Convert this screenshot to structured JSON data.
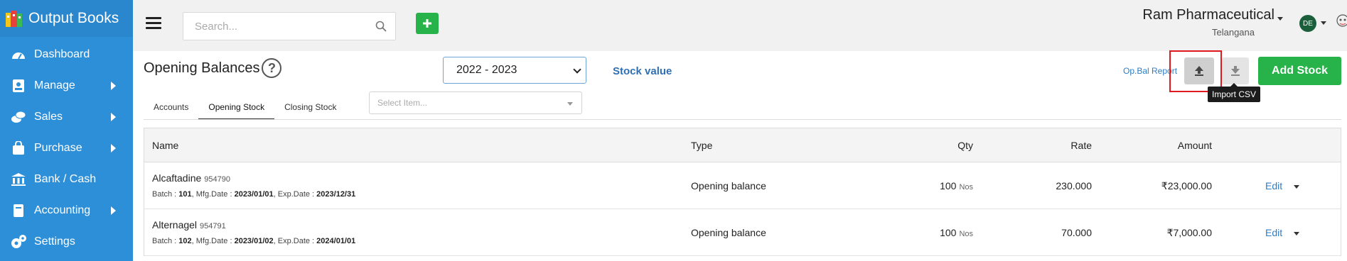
{
  "brand": {
    "name": "Output Books"
  },
  "sidebar": {
    "items": [
      {
        "label": "Dashboard",
        "icon": "dashboard-gauge-icon",
        "has_submenu": false
      },
      {
        "label": "Manage",
        "icon": "manage-id-card-icon",
        "has_submenu": true
      },
      {
        "label": "Sales",
        "icon": "sales-coins-icon",
        "has_submenu": true
      },
      {
        "label": "Purchase",
        "icon": "purchase-bag-icon",
        "has_submenu": true
      },
      {
        "label": "Bank / Cash",
        "icon": "bank-icon",
        "has_submenu": false
      },
      {
        "label": "Accounting",
        "icon": "accounting-book-icon",
        "has_submenu": true
      },
      {
        "label": "Settings",
        "icon": "settings-gears-icon",
        "has_submenu": false
      }
    ]
  },
  "header": {
    "search_placeholder": "Search...",
    "company_name": "Ram Pharmaceutical",
    "company_state": "Telangana",
    "avatar_initials": "DE"
  },
  "page": {
    "title": "Opening Balances",
    "help": "?",
    "year": "2022 - 2023",
    "stock_value_link": "Stock value",
    "op_bal_report_link": "Op.Bal Report",
    "add_stock_label": "Add Stock",
    "import_tooltip": "Import CSV",
    "tabs": [
      {
        "label": "Accounts",
        "active": false
      },
      {
        "label": "Opening Stock",
        "active": true
      },
      {
        "label": "Closing Stock",
        "active": false
      }
    ],
    "item_select_placeholder": "Select Item..."
  },
  "table": {
    "headers": {
      "name": "Name",
      "type": "Type",
      "qty": "Qty",
      "rate": "Rate",
      "amount": "Amount"
    },
    "rows": [
      {
        "name": "Alcaftadine",
        "code": "954790",
        "batch_label": "Batch : ",
        "batch": "101",
        "mfg_label": ", Mfg.Date : ",
        "mfg": "2023/01/01",
        "exp_label": ", Exp.Date : ",
        "exp": "2023/12/31",
        "type": "Opening balance",
        "qty": "100",
        "unit": "Nos",
        "rate": "230.000",
        "amount": "₹23,000.00",
        "action": "Edit"
      },
      {
        "name": "Alternagel",
        "code": "954791",
        "batch_label": "Batch : ",
        "batch": "102",
        "mfg_label": ", Mfg.Date : ",
        "mfg": "2023/01/02",
        "exp_label": ", Exp.Date : ",
        "exp": "2024/01/01",
        "type": "Opening balance",
        "qty": "100",
        "unit": "Nos",
        "rate": "70.000",
        "amount": "₹7,000.00",
        "action": "Edit"
      }
    ]
  },
  "colors": {
    "sidebar": "#2e8fd9",
    "accent_green": "#27b34a",
    "link_blue": "#2f7dc4",
    "highlight_red": "#e0191f"
  }
}
